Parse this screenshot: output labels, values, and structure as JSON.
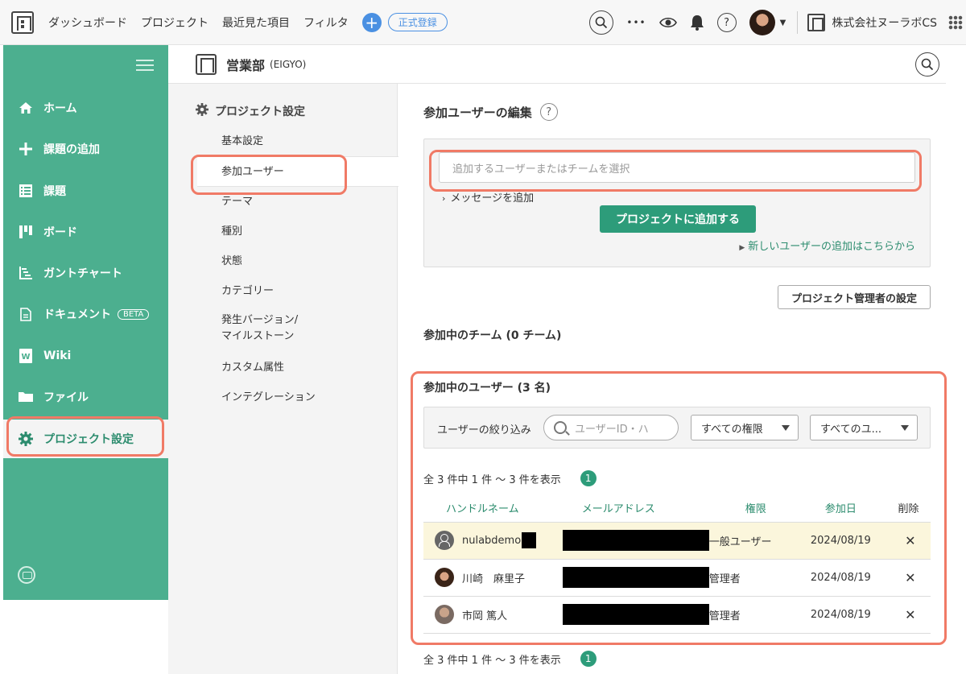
{
  "topbar": {
    "nav": [
      "ダッシュボード",
      "プロジェクト",
      "最近見た項目",
      "フィルタ"
    ],
    "add_icon": "plus-icon",
    "register_label": "正式登録",
    "icons": [
      "search-icon",
      "more-icon",
      "eye-icon",
      "bell-icon",
      "help-icon",
      "apps-grid-icon"
    ],
    "more_glyph": "•••",
    "help_glyph": "?",
    "org_name": "株式会社ヌーラボCS"
  },
  "sidebar": {
    "items": [
      {
        "label": "ホーム",
        "icon": "home-icon"
      },
      {
        "label": "課題の追加",
        "icon": "plus-icon"
      },
      {
        "label": "課題",
        "icon": "list-icon"
      },
      {
        "label": "ボード",
        "icon": "board-icon"
      },
      {
        "label": "ガントチャート",
        "icon": "gantt-icon"
      },
      {
        "label": "ドキュメント",
        "icon": "document-icon",
        "badge": "BETA"
      },
      {
        "label": "Wiki",
        "icon": "wiki-icon"
      },
      {
        "label": "ファイル",
        "icon": "folder-icon"
      },
      {
        "label": "プロジェクト設定",
        "icon": "gear-icon",
        "active": true
      }
    ]
  },
  "project": {
    "name": "営業部",
    "key": "(EIGYO)"
  },
  "settings_nav": {
    "title": "プロジェクト設定",
    "items": [
      "基本設定",
      "参加ユーザー",
      "テーマ",
      "種別",
      "状態",
      "カテゴリー",
      "発生バージョン/",
      "マイルストーン",
      "カスタム属性",
      "インテグレーション"
    ],
    "active": "参加ユーザー"
  },
  "main": {
    "edit_title": "参加ユーザーの編集",
    "help_glyph": "?",
    "add_placeholder": "追加するユーザーまたはチームを選択",
    "add_message": "メッセージを追加",
    "add_button": "プロジェクトに追加する",
    "new_user_link": "新しいユーザーの追加はこちらから",
    "admin_button": "プロジェクト管理者の設定",
    "teams_heading": "参加中のチーム (0 チーム)",
    "users_heading": "参加中のユーザー (3 名)",
    "filter": {
      "label": "ユーザーの絞り込み",
      "search_placeholder": "ユーザーID・ハ",
      "role_select": "すべての権限",
      "user_select": "すべてのユ..."
    },
    "count_text": "全 3 件中 1 件 ～ 3 件を表示",
    "page": "1",
    "table": {
      "headers": [
        "ハンドルネーム",
        "メールアドレス",
        "権限",
        "参加日",
        "削除"
      ],
      "rows": [
        {
          "name": "nulabdemo-",
          "role": "一般ユーザー",
          "joined": "2024/08/19",
          "delete": "✕",
          "avatar": "default-avatar-icon"
        },
        {
          "name": "川崎　麻里子",
          "role": "管理者",
          "joined": "2024/08/19",
          "delete": "✕",
          "avatar": "avatar"
        },
        {
          "name": "市岡 篤人",
          "role": "管理者",
          "joined": "2024/08/19",
          "delete": "✕",
          "avatar": "avatar"
        }
      ]
    }
  },
  "colors": {
    "accent": "#2d9c7a",
    "sidebar": "#4caf8f",
    "highlight": "#f07a66",
    "row_highlight": "#fbf6dc"
  }
}
